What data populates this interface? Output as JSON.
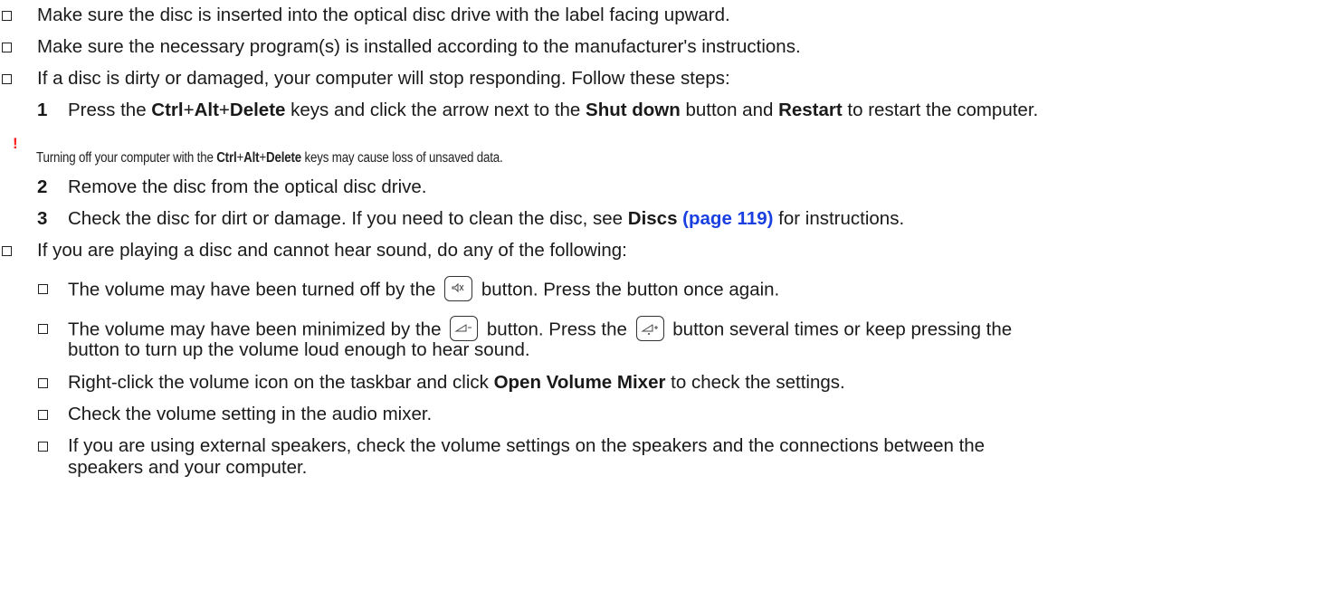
{
  "items": {
    "insert_disc": "Make sure the disc is inserted into the optical disc drive with the label facing upward.",
    "program_installed": "Make sure the necessary program(s) is installed according to the manufacturer's instructions.",
    "dirty_disc": "If a disc is dirty or damaged, your computer will stop responding. Follow these steps:"
  },
  "steps": {
    "step1": {
      "number": "1",
      "t1": "Press the ",
      "k1": "Ctrl",
      "plus1": "+",
      "k2": "Alt",
      "plus2": "+",
      "k3": "Delete",
      "t2": " keys and click the arrow next to the ",
      "shutdown": "Shut down",
      "t3": " button and ",
      "restart": "Restart",
      "t4": " to restart the computer."
    },
    "warning": {
      "mark": "!",
      "t1": "Turning off your computer with the ",
      "k1": "Ctrl",
      "plus1": "+",
      "k2": "Alt",
      "plus2": "+",
      "k3": "Delete",
      "t2": " keys may cause loss of unsaved data."
    },
    "step2": {
      "number": "2",
      "text": "Remove the disc from the optical disc drive."
    },
    "step3": {
      "number": "3",
      "t1": "Check the disc for dirt or damage. If you need to clean the disc, see ",
      "discs": "Discs",
      "link": " (page 119)",
      "t2": " for instructions."
    }
  },
  "sound": {
    "intro": "If you are playing a disc and cannot hear sound, do any of the following:",
    "mute": {
      "t1": "The volume may have been turned off by the",
      "t2": "button. Press the button once again."
    },
    "minimized": {
      "t1": "The volume may have been minimized by the",
      "t2": "button. Press the",
      "t3": "button several times or keep pressing the",
      "t4": "button to turn up the volume loud enough to hear sound."
    },
    "mixer": {
      "t1": "Right-click the volume icon on the taskbar and click ",
      "bold": "Open Volume Mixer",
      "t2": " to check the settings."
    },
    "audio_mixer": "Check the volume setting in the audio mixer.",
    "external": {
      "l1": "If you are using external speakers, check the volume settings on the speakers and the connections between the",
      "l2": "speakers and your computer."
    }
  },
  "icons": [
    "mute-key-icon",
    "volume-down-key-icon",
    "volume-up-key-icon",
    "checkbox-bullet-icon"
  ],
  "colors": {
    "link": "#1a3fe0",
    "warning": "#ff1a1a",
    "text": "#1a1a1a"
  }
}
